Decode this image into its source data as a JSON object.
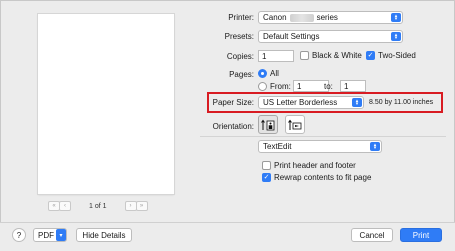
{
  "preview": {
    "page_indicator": "1 of 1",
    "first_glyph": "«",
    "prev_glyph": "‹",
    "next_glyph": "›",
    "last_glyph": "»"
  },
  "printer": {
    "label": "Printer:",
    "value_prefix": "Canon",
    "value_suffix": "series"
  },
  "presets": {
    "label": "Presets:",
    "value": "Default Settings"
  },
  "copies": {
    "label": "Copies:",
    "value": "1",
    "bw_label": "Black & White",
    "bw_checked": false,
    "two_sided_label": "Two-Sided",
    "two_sided_checked": true
  },
  "pages": {
    "label": "Pages:",
    "all_label": "All",
    "from_label": "From:",
    "from_value": "1",
    "to_label": "to:",
    "to_value": "1",
    "selected": "All"
  },
  "paper_size": {
    "label": "Paper Size:",
    "value": "US Letter Borderless",
    "dimensions": "8.50 by 11.00 inches",
    "highlight_color": "#d81b22"
  },
  "orientation": {
    "label": "Orientation:",
    "selected": "portrait"
  },
  "app_menu": {
    "value": "TextEdit"
  },
  "options": [
    {
      "label": "Print header and footer",
      "checked": false
    },
    {
      "label": "Rewrap contents to fit page",
      "checked": true
    }
  ],
  "footer": {
    "help": "?",
    "pdf_label": "PDF",
    "hide_details_label": "Hide Details",
    "cancel_label": "Cancel",
    "print_label": "Print"
  },
  "colors": {
    "accent": "#2f7cf6",
    "background": "#ececec"
  }
}
